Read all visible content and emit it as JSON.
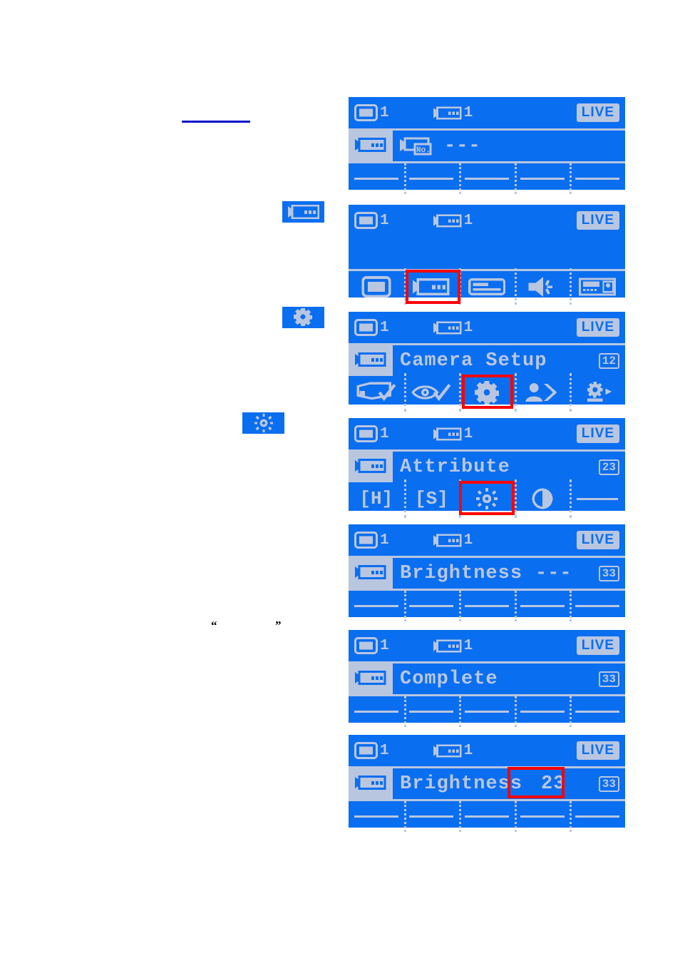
{
  "marks": {
    "underline": "",
    "quote_open": "“",
    "quote_close": "”"
  },
  "colors": {
    "osd_background": "#0a6ef0",
    "osd_foreground": "#b9c6e0",
    "selection_highlight": "#ff0000",
    "underline": "#0a13c8"
  },
  "badges": [
    {
      "id": "badge-camera",
      "icon": "camera-icon",
      "label": "camera"
    },
    {
      "id": "badge-gear",
      "icon": "gear-icon",
      "label": "gear"
    },
    {
      "id": "badge-brightness",
      "icon": "brightness-icon",
      "label": "brightness"
    }
  ],
  "status": {
    "monitor_icon": "monitor-icon",
    "monitor_number": "1",
    "camera_icon": "camera-icon",
    "camera_number": "1",
    "live_label": "LIVE"
  },
  "panels": [
    {
      "id": "panel-camera-number",
      "status": {
        "monitor_number": "1",
        "camera_number": "1",
        "live_label": "LIVE"
      },
      "title": {
        "tab_icon": "camera-icon",
        "prefix_icon": "camera-no-icon",
        "text": "",
        "value": "---",
        "badge": ""
      },
      "footer": {
        "type": "dashes",
        "cells": [
          "",
          "",
          "",
          "",
          ""
        ]
      },
      "selection": null
    },
    {
      "id": "panel-main-menu",
      "status": {
        "monitor_number": "1",
        "camera_number": "1",
        "live_label": "LIVE"
      },
      "title": null,
      "menu": {
        "items": [
          {
            "icon": "monitor-icon",
            "label": "Monitor"
          },
          {
            "icon": "camera-icon",
            "label": "Camera"
          },
          {
            "icon": "recorder-icon",
            "label": "Recorder"
          },
          {
            "icon": "speaker-icon",
            "label": "Audio"
          },
          {
            "icon": "controller-icon",
            "label": "System"
          }
        ],
        "selected_index": 1
      },
      "selection": "camera"
    },
    {
      "id": "panel-camera-setup",
      "status": {
        "monitor_number": "1",
        "camera_number": "1",
        "live_label": "LIVE"
      },
      "title": {
        "tab_icon": "camera-icon",
        "text": "Camera Setup",
        "value": "",
        "badge": "12"
      },
      "menu": {
        "items": [
          {
            "icon": "scene-check-icon",
            "label": "Scene"
          },
          {
            "icon": "eye-check-icon",
            "label": "View"
          },
          {
            "icon": "gear-icon",
            "label": "Attribute"
          },
          {
            "icon": "person-layers-icon",
            "label": "Privacy"
          },
          {
            "icon": "camera-settings-icon",
            "label": "Camera Settings"
          }
        ],
        "selected_index": 2
      },
      "selection": "gear"
    },
    {
      "id": "panel-attribute",
      "status": {
        "monitor_number": "1",
        "camera_number": "1",
        "live_label": "LIVE"
      },
      "title": {
        "tab_icon": "camera-icon",
        "text": "Attribute",
        "value": "",
        "badge": "23"
      },
      "menu": {
        "items": [
          {
            "icon": "",
            "label": "[H]"
          },
          {
            "icon": "",
            "label": "[S]"
          },
          {
            "icon": "brightness-icon",
            "label": "Brightness"
          },
          {
            "icon": "contrast-icon",
            "label": "Contrast"
          },
          {
            "icon": "dash",
            "label": ""
          }
        ],
        "selected_index": 2
      },
      "selection": "brightness"
    },
    {
      "id": "panel-brightness-empty",
      "status": {
        "monitor_number": "1",
        "camera_number": "1",
        "live_label": "LIVE"
      },
      "title": {
        "tab_icon": "camera-icon",
        "text": "Brightness",
        "value": "---",
        "badge": "33"
      },
      "footer": {
        "type": "dashes",
        "cells": [
          "",
          "",
          "",
          "",
          ""
        ]
      },
      "selection": null
    },
    {
      "id": "panel-complete",
      "status": {
        "monitor_number": "1",
        "camera_number": "1",
        "live_label": "LIVE"
      },
      "title": {
        "tab_icon": "camera-icon",
        "text": "Complete",
        "value": "",
        "badge": "33"
      },
      "footer": {
        "type": "dashes",
        "cells": [
          "",
          "",
          "",
          "",
          ""
        ]
      },
      "selection": null
    },
    {
      "id": "panel-brightness-value",
      "status": {
        "monitor_number": "1",
        "camera_number": "1",
        "live_label": "LIVE"
      },
      "title": {
        "tab_icon": "camera-icon",
        "text": "Brightness",
        "value": "23",
        "badge": "33"
      },
      "footer": {
        "type": "dashes",
        "cells": [
          "",
          "",
          "",
          "",
          ""
        ]
      },
      "selection": "value"
    }
  ]
}
